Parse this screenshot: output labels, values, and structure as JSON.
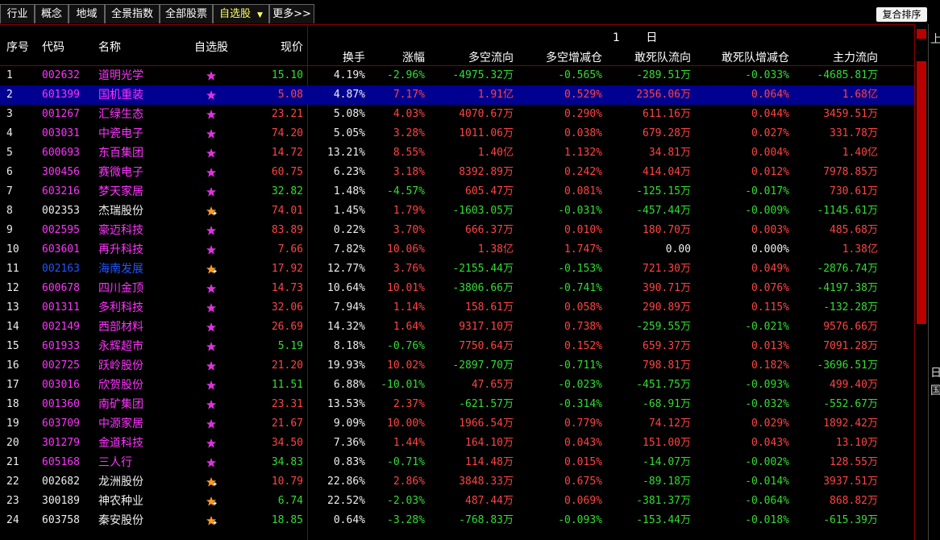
{
  "tabs": [
    {
      "label": "行业"
    },
    {
      "label": "概念"
    },
    {
      "label": "地域"
    },
    {
      "label": "全景指数"
    },
    {
      "label": "全部股票"
    },
    {
      "label": "自选股"
    },
    {
      "label": "更多>>"
    }
  ],
  "sort_button": "复合排序",
  "group_title": "1 日",
  "headers": {
    "seq": "序号",
    "code": "代码",
    "name": "名称",
    "fav": "自选股",
    "price": "现价",
    "turnover": "换手",
    "change": "涨幅",
    "flow": "多空流向",
    "flow_delta": "多空增减仓",
    "dare": "敢死队流向",
    "dare_delta": "敢死队增减仓",
    "main": "主力流向"
  },
  "side_chars": {
    "top": "上",
    "mid": "日",
    "mid2": "国"
  },
  "rows": [
    {
      "seq": "1",
      "code": "002632",
      "name": "道明光学",
      "price": "15.10",
      "turnover": "4.19%",
      "change": "-2.96%",
      "flow": "-4975.32万",
      "flow_delta": "-0.565%",
      "dare": "-289.51万",
      "dare_delta": "-0.033%",
      "main": "-4685.81万",
      "cc": "mag",
      "star": "plain"
    },
    {
      "seq": "2",
      "code": "601399",
      "name": "国机重装",
      "price": "5.08",
      "turnover": "4.87%",
      "change": "7.17%",
      "flow": "1.91亿",
      "flow_delta": "0.529%",
      "dare": "2356.06万",
      "dare_delta": "0.064%",
      "main": "1.68亿",
      "cc": "mag",
      "star": "plain",
      "sel": true
    },
    {
      "seq": "3",
      "code": "001267",
      "name": "汇绿生态",
      "price": "23.21",
      "turnover": "5.08%",
      "change": "4.03%",
      "flow": "4070.67万",
      "flow_delta": "0.290%",
      "dare": "611.16万",
      "dare_delta": "0.044%",
      "main": "3459.51万",
      "cc": "mag",
      "star": "plain"
    },
    {
      "seq": "4",
      "code": "003031",
      "name": "中瓷电子",
      "price": "74.20",
      "turnover": "5.05%",
      "change": "3.28%",
      "flow": "1011.06万",
      "flow_delta": "0.038%",
      "dare": "679.28万",
      "dare_delta": "0.027%",
      "main": "331.78万",
      "cc": "mag",
      "star": "plain"
    },
    {
      "seq": "5",
      "code": "600693",
      "name": "东百集团",
      "price": "14.72",
      "turnover": "13.21%",
      "change": "8.55%",
      "flow": "1.40亿",
      "flow_delta": "1.132%",
      "dare": "34.81万",
      "dare_delta": "0.004%",
      "main": "1.40亿",
      "cc": "mag",
      "star": "plain"
    },
    {
      "seq": "6",
      "code": "300456",
      "name": "赛微电子",
      "price": "60.75",
      "turnover": "6.23%",
      "change": "3.18%",
      "flow": "8392.89万",
      "flow_delta": "0.242%",
      "dare": "414.04万",
      "dare_delta": "0.012%",
      "main": "7978.85万",
      "cc": "mag",
      "star": "plain"
    },
    {
      "seq": "7",
      "code": "603216",
      "name": "梦天家居",
      "price": "32.82",
      "turnover": "1.48%",
      "change": "-4.57%",
      "flow": "605.47万",
      "flow_delta": "0.081%",
      "dare": "-125.15万",
      "dare_delta": "-0.017%",
      "main": "730.61万",
      "cc": "mag",
      "star": "plain"
    },
    {
      "seq": "8",
      "code": "002353",
      "name": "杰瑞股份",
      "price": "74.01",
      "turnover": "1.45%",
      "change": "1.79%",
      "flow": "-1603.05万",
      "flow_delta": "-0.031%",
      "dare": "-457.44万",
      "dare_delta": "-0.009%",
      "main": "-1145.61万",
      "cc": "white",
      "star": "plus"
    },
    {
      "seq": "9",
      "code": "002595",
      "name": "豪迈科技",
      "price": "83.89",
      "turnover": "0.22%",
      "change": "3.70%",
      "flow": "666.37万",
      "flow_delta": "0.010%",
      "dare": "180.70万",
      "dare_delta": "0.003%",
      "main": "485.68万",
      "cc": "mag",
      "star": "plain"
    },
    {
      "seq": "10",
      "code": "603601",
      "name": "再升科技",
      "price": "7.66",
      "turnover": "7.82%",
      "change": "10.06%",
      "flow": "1.38亿",
      "flow_delta": "1.747%",
      "dare": "0.00",
      "dare_delta": "0.000%",
      "main": "1.38亿",
      "cc": "mag",
      "star": "plain"
    },
    {
      "seq": "11",
      "code": "002163",
      "name": "海南发展",
      "price": "17.92",
      "turnover": "12.77%",
      "change": "3.76%",
      "flow": "-2155.44万",
      "flow_delta": "-0.153%",
      "dare": "721.30万",
      "dare_delta": "0.049%",
      "main": "-2876.74万",
      "cc": "blue",
      "star": "plus"
    },
    {
      "seq": "12",
      "code": "600678",
      "name": "四川金顶",
      "price": "14.73",
      "turnover": "10.64%",
      "change": "10.01%",
      "flow": "-3806.66万",
      "flow_delta": "-0.741%",
      "dare": "390.71万",
      "dare_delta": "0.076%",
      "main": "-4197.38万",
      "cc": "mag",
      "star": "plain"
    },
    {
      "seq": "13",
      "code": "001311",
      "name": "多利科技",
      "price": "32.06",
      "turnover": "7.94%",
      "change": "1.14%",
      "flow": "158.61万",
      "flow_delta": "0.058%",
      "dare": "290.89万",
      "dare_delta": "0.115%",
      "main": "-132.28万",
      "cc": "mag",
      "star": "plain"
    },
    {
      "seq": "14",
      "code": "002149",
      "name": "西部材料",
      "price": "26.69",
      "turnover": "14.32%",
      "change": "1.64%",
      "flow": "9317.10万",
      "flow_delta": "0.738%",
      "dare": "-259.55万",
      "dare_delta": "-0.021%",
      "main": "9576.66万",
      "cc": "mag",
      "star": "plain"
    },
    {
      "seq": "15",
      "code": "601933",
      "name": "永辉超市",
      "price": "5.19",
      "turnover": "8.18%",
      "change": "-0.76%",
      "flow": "7750.64万",
      "flow_delta": "0.152%",
      "dare": "659.37万",
      "dare_delta": "0.013%",
      "main": "7091.28万",
      "cc": "mag",
      "star": "plain"
    },
    {
      "seq": "16",
      "code": "002725",
      "name": "跃岭股份",
      "price": "21.20",
      "turnover": "19.93%",
      "change": "10.02%",
      "flow": "-2897.70万",
      "flow_delta": "-0.711%",
      "dare": "798.81万",
      "dare_delta": "0.182%",
      "main": "-3696.51万",
      "cc": "mag",
      "star": "plain"
    },
    {
      "seq": "17",
      "code": "003016",
      "name": "欣贺股份",
      "price": "11.51",
      "turnover": "6.88%",
      "change": "-10.01%",
      "flow": "47.65万",
      "flow_delta": "-0.023%",
      "dare": "-451.75万",
      "dare_delta": "-0.093%",
      "main": "499.40万",
      "cc": "mag",
      "star": "plain"
    },
    {
      "seq": "18",
      "code": "001360",
      "name": "南矿集团",
      "price": "23.31",
      "turnover": "13.53%",
      "change": "2.37%",
      "flow": "-621.57万",
      "flow_delta": "-0.314%",
      "dare": "-68.91万",
      "dare_delta": "-0.032%",
      "main": "-552.67万",
      "cc": "mag",
      "star": "plain"
    },
    {
      "seq": "19",
      "code": "603709",
      "name": "中源家居",
      "price": "21.67",
      "turnover": "9.09%",
      "change": "10.00%",
      "flow": "1966.54万",
      "flow_delta": "0.779%",
      "dare": "74.12万",
      "dare_delta": "0.029%",
      "main": "1892.42万",
      "cc": "mag",
      "star": "plain"
    },
    {
      "seq": "20",
      "code": "301279",
      "name": "金道科技",
      "price": "34.50",
      "turnover": "7.36%",
      "change": "1.44%",
      "flow": "164.10万",
      "flow_delta": "0.043%",
      "dare": "151.00万",
      "dare_delta": "0.043%",
      "main": "13.10万",
      "cc": "mag",
      "star": "plain"
    },
    {
      "seq": "21",
      "code": "605168",
      "name": "三人行",
      "price": "34.83",
      "turnover": "0.83%",
      "change": "-0.71%",
      "flow": "114.48万",
      "flow_delta": "0.015%",
      "dare": "-14.07万",
      "dare_delta": "-0.002%",
      "main": "128.55万",
      "cc": "mag",
      "star": "plain"
    },
    {
      "seq": "22",
      "code": "002682",
      "name": "龙洲股份",
      "price": "10.79",
      "turnover": "22.86%",
      "change": "2.86%",
      "flow": "3848.33万",
      "flow_delta": "0.675%",
      "dare": "-89.18万",
      "dare_delta": "-0.014%",
      "main": "3937.51万",
      "cc": "white",
      "star": "plus"
    },
    {
      "seq": "23",
      "code": "300189",
      "name": "神农种业",
      "price": "6.74",
      "turnover": "22.52%",
      "change": "-2.03%",
      "flow": "487.44万",
      "flow_delta": "0.069%",
      "dare": "-381.37万",
      "dare_delta": "-0.064%",
      "main": "868.82万",
      "cc": "white",
      "star": "plus"
    },
    {
      "seq": "24",
      "code": "603758",
      "name": "秦安股份",
      "price": "18.85",
      "turnover": "0.64%",
      "change": "-3.28%",
      "flow": "-768.83万",
      "flow_delta": "-0.093%",
      "dare": "-153.44万",
      "dare_delta": "-0.018%",
      "main": "-615.39万",
      "cc": "white",
      "star": "plus"
    }
  ],
  "colors": {
    "up": "#ff4444",
    "down": "#33dd33",
    "selected_row": "#000090",
    "grid_line": "#8b0000"
  }
}
